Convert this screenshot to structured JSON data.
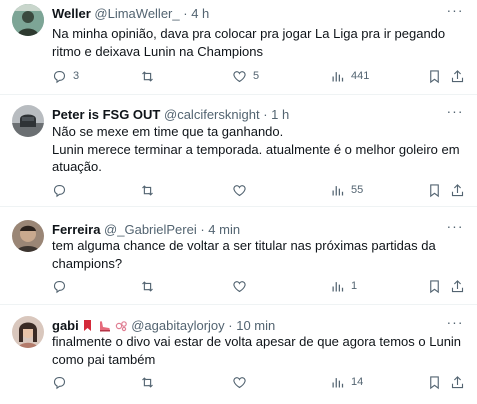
{
  "tweets": [
    {
      "name": "Weller",
      "handle": "@LimaWeller_",
      "time": "· 4 h",
      "text": "Na minha opinião, dava pra colocar pra jogar La Liga pra ir pegando ritmo e deixava Lunin na Champions",
      "replies": "3",
      "retweets": "",
      "likes": "5",
      "views": "441"
    },
    {
      "name": "Peter is FSG OUT",
      "handle": "@calcifersknight",
      "time": "· 1 h",
      "text": "Não se mexe em time que ta ganhando.\nLunin merece terminar a temporada. atualmente é o melhor goleiro em atuação.",
      "replies": "",
      "retweets": "",
      "likes": "",
      "views": "55"
    },
    {
      "name": "Ferreira",
      "handle": "@_GabrielPerei",
      "time": "· 4 min",
      "text": "tem alguma chance de voltar a ser titular nas próximas partidas da champions?",
      "replies": "",
      "retweets": "",
      "likes": "",
      "views": "1"
    },
    {
      "name": "gabi",
      "handle": "@agabitaylorjoy",
      "time": "· 10 min",
      "text": "finalmente o divo vai estar de volta apesar de que agora temos o Lunin como pai também",
      "replies": "",
      "retweets": "",
      "likes": "",
      "views": "14"
    }
  ],
  "icons": {
    "more": "more-dots-icon",
    "reply": "reply-icon",
    "retweet": "retweet-icon",
    "like": "heart-icon",
    "views": "views-chart-icon",
    "bookmark": "bookmark-icon",
    "share": "share-icon"
  },
  "colors": {
    "text": "#0f1419",
    "secondary": "#536471",
    "divider": "#eff3f4"
  }
}
